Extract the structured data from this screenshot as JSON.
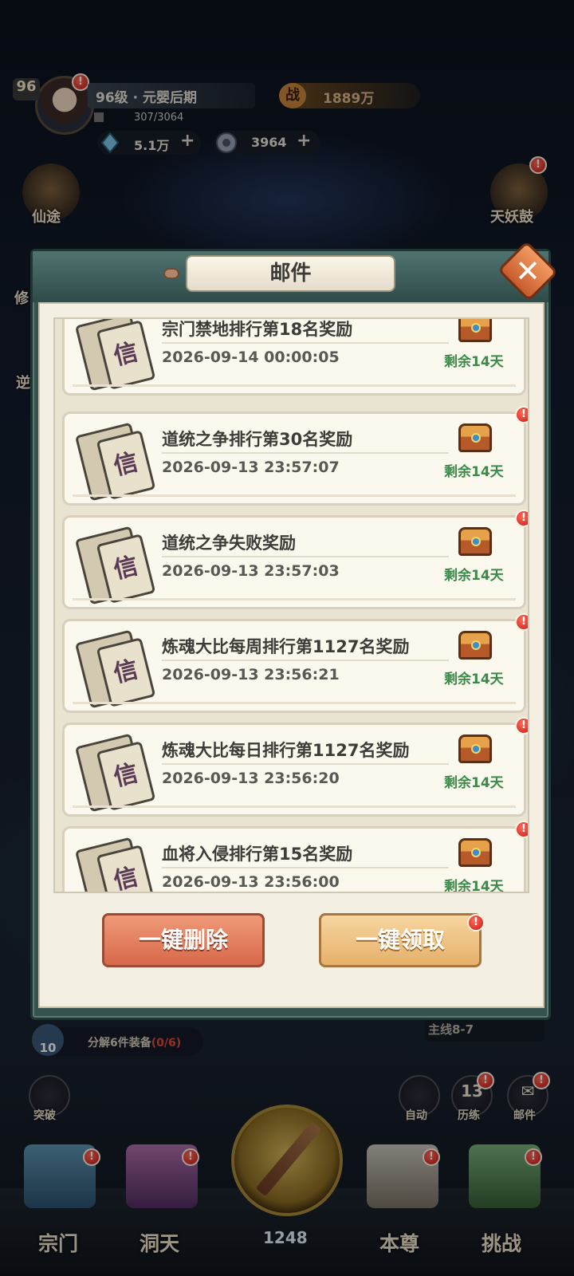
{
  "player": {
    "level_badge": "96",
    "realm": "96级 · 元婴后期",
    "exp": "307/3064",
    "power_icon": "战",
    "power": "1889万",
    "currency_crystal": "5.1万",
    "currency_coin": "3964",
    "plus": "+"
  },
  "side_buttons": {
    "xiantu": "仙途",
    "tianyaogu": "天妖鼓",
    "xiu": "修",
    "ni": "逆"
  },
  "mail": {
    "title": "邮件",
    "close_label": "✕",
    "items": [
      {
        "title": "宗门禁地排行第18名奖励",
        "date": "2026-09-14 00:00:05",
        "remaining": "剩余14天",
        "envelope_char": "信"
      },
      {
        "title": "道统之争排行第30名奖励",
        "date": "2026-09-13 23:57:07",
        "remaining": "剩余14天",
        "envelope_char": "信"
      },
      {
        "title": "道统之争失败奖励",
        "date": "2026-09-13 23:57:03",
        "remaining": "剩余14天",
        "envelope_char": "信"
      },
      {
        "title": "炼魂大比每周排行第1127名奖励",
        "date": "2026-09-13 23:56:21",
        "remaining": "剩余14天",
        "envelope_char": "信"
      },
      {
        "title": "炼魂大比每日排行第1127名奖励",
        "date": "2026-09-13 23:56:20",
        "remaining": "剩余14天",
        "envelope_char": "信"
      },
      {
        "title": "血将入侵排行第15名奖励",
        "date": "2026-09-13 23:56:00",
        "remaining": "剩余14天",
        "envelope_char": "信"
      }
    ],
    "delete_all": "一键删除",
    "claim_all": "一键领取"
  },
  "hud": {
    "equip_level": "10",
    "equip_text": "分解6件装备",
    "equip_count": "(0/6)",
    "mainline": "主线8-7",
    "breakthrough": "突破",
    "auto": "自动",
    "training_count": "13",
    "training": "历练",
    "mailbox": "邮件",
    "alert": "!"
  },
  "nav": {
    "sect": "宗门",
    "cave": "洞天",
    "center_value": "1248",
    "self": "本尊",
    "challenge": "挑战"
  },
  "colors": {
    "remaining_green": "#3c8a4a",
    "alert_red": "#c91a12",
    "modal_teal": "#35524f"
  }
}
